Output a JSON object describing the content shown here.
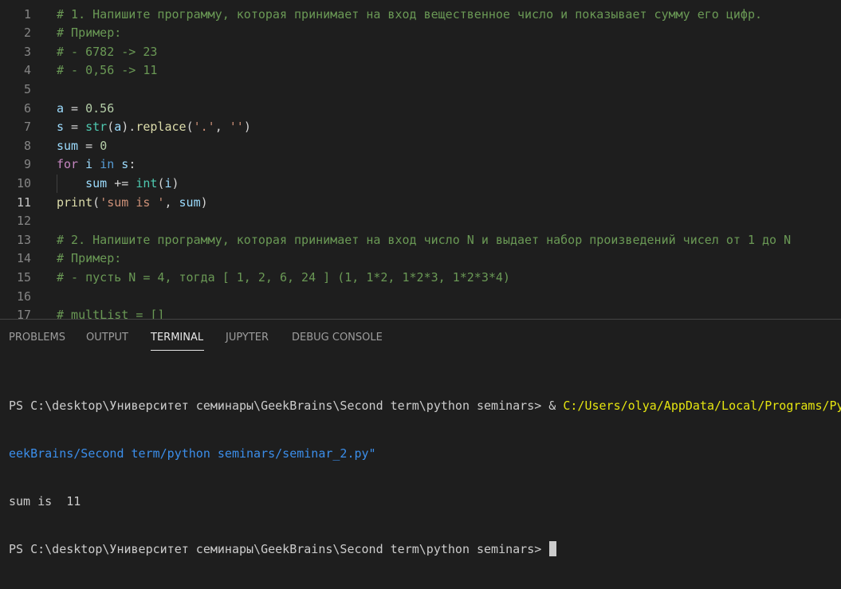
{
  "editor": {
    "lines": [
      {
        "n": "1",
        "parts": [
          {
            "t": "# 1. Напишите программу, которая принимает на вход вещественное число и показывает сумму его цифр.",
            "c": "com"
          }
        ]
      },
      {
        "n": "2",
        "parts": [
          {
            "t": "# Пример:",
            "c": "com"
          }
        ]
      },
      {
        "n": "3",
        "parts": [
          {
            "t": "# - 6782 -> 23",
            "c": "com"
          }
        ]
      },
      {
        "n": "4",
        "parts": [
          {
            "t": "# - 0,56 -> 11",
            "c": "com"
          }
        ]
      },
      {
        "n": "5",
        "parts": []
      },
      {
        "n": "6",
        "parts": [
          {
            "t": "a",
            "c": "var"
          },
          {
            "t": " = ",
            "c": "op"
          },
          {
            "t": "0.56",
            "c": "num"
          }
        ]
      },
      {
        "n": "7",
        "parts": [
          {
            "t": "s",
            "c": "var"
          },
          {
            "t": " = ",
            "c": "op"
          },
          {
            "t": "str",
            "c": "cls"
          },
          {
            "t": "(",
            "c": "op"
          },
          {
            "t": "a",
            "c": "var"
          },
          {
            "t": ").",
            "c": "op"
          },
          {
            "t": "replace",
            "c": "fn"
          },
          {
            "t": "(",
            "c": "op"
          },
          {
            "t": "'.'",
            "c": "str"
          },
          {
            "t": ", ",
            "c": "op"
          },
          {
            "t": "''",
            "c": "str"
          },
          {
            "t": ")",
            "c": "op"
          }
        ]
      },
      {
        "n": "8",
        "parts": [
          {
            "t": "sum",
            "c": "var"
          },
          {
            "t": " = ",
            "c": "op"
          },
          {
            "t": "0",
            "c": "num"
          }
        ]
      },
      {
        "n": "9",
        "parts": [
          {
            "t": "for",
            "c": "kw"
          },
          {
            "t": " ",
            "c": "op"
          },
          {
            "t": "i",
            "c": "var"
          },
          {
            "t": " ",
            "c": "op"
          },
          {
            "t": "in",
            "c": "kw2"
          },
          {
            "t": " ",
            "c": "op"
          },
          {
            "t": "s",
            "c": "var"
          },
          {
            "t": ":",
            "c": "op"
          }
        ]
      },
      {
        "n": "10",
        "parts": [
          {
            "t": "    ",
            "c": "op"
          },
          {
            "t": "sum",
            "c": "var"
          },
          {
            "t": " += ",
            "c": "op"
          },
          {
            "t": "int",
            "c": "cls"
          },
          {
            "t": "(",
            "c": "op"
          },
          {
            "t": "i",
            "c": "var"
          },
          {
            "t": ")",
            "c": "op"
          }
        ],
        "guide": true
      },
      {
        "n": "11",
        "parts": [
          {
            "t": "print",
            "c": "fn"
          },
          {
            "t": "(",
            "c": "op"
          },
          {
            "t": "'sum is '",
            "c": "str"
          },
          {
            "t": ", ",
            "c": "op"
          },
          {
            "t": "sum",
            "c": "var"
          },
          {
            "t": ")",
            "c": "op"
          }
        ],
        "current": true
      },
      {
        "n": "12",
        "parts": []
      },
      {
        "n": "13",
        "parts": [
          {
            "t": "# 2. Напишите программу, которая принимает на вход число N и выдает набор произведений чисел от 1 до N",
            "c": "com"
          }
        ]
      },
      {
        "n": "14",
        "parts": [
          {
            "t": "# Пример:",
            "c": "com"
          }
        ]
      },
      {
        "n": "15",
        "parts": [
          {
            "t": "# - пусть N = 4, тогда [ 1, 2, 6, 24 ] (1, 1*2, 1*2*3, 1*2*3*4)",
            "c": "com"
          }
        ]
      },
      {
        "n": "16",
        "parts": []
      },
      {
        "n": "17",
        "parts": [
          {
            "t": "# multList = []",
            "c": "com"
          }
        ]
      }
    ]
  },
  "panel": {
    "tabs": [
      {
        "label": "PROBLEMS",
        "active": false
      },
      {
        "label": "OUTPUT",
        "active": false
      },
      {
        "label": "TERMINAL",
        "active": true
      },
      {
        "label": "JUPYTER",
        "active": false
      },
      {
        "label": "DEBUG CONSOLE",
        "active": false
      }
    ]
  },
  "terminal": {
    "line1_prompt": "PS C:\\desktop\\Университет семинары\\GeekBrains\\Second term\\python seminars> & ",
    "line1_path": "C:/Users/olya/AppData/Local/Programs/Py",
    "line2_cont": "eekBrains/Second term/python seminars/seminar_2.py\"",
    "line3_output": "sum is  11",
    "line4_prompt": "PS C:\\desktop\\Университет семинары\\GeekBrains\\Second term\\python seminars> "
  },
  "colors": {
    "background": "#1e1e1e",
    "comment": "#6a9955",
    "variable": "#9cdcfe",
    "number": "#b5cea8",
    "function": "#dcdcaa",
    "class": "#4ec9b0",
    "string": "#ce9178",
    "keyword_control": "#c586c0",
    "keyword": "#569cd6",
    "terminal_path": "#e5e510",
    "terminal_continuation": "#3b8eea"
  }
}
